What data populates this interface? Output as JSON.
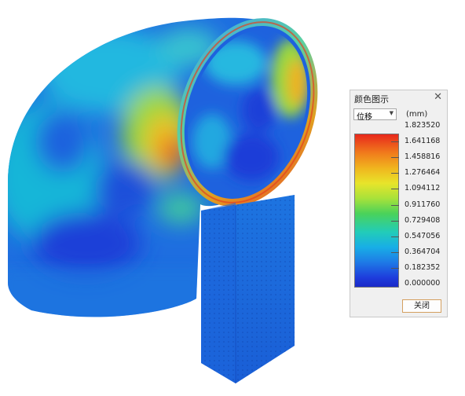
{
  "legend": {
    "title": "颜色图示",
    "close_icon": "close-icon",
    "quantity_select": {
      "value": "位移",
      "arrow_icon": "chevron-down-icon"
    },
    "unit": "(mm)",
    "max_color": "#e8281c",
    "min_color": "#1a2ac8",
    "labels": [
      "1.823520",
      "1.641168",
      "1.458816",
      "1.276464",
      "1.094112",
      "0.911760",
      "0.729408",
      "0.547056",
      "0.364704",
      "0.182352",
      "0.000000"
    ],
    "close_button": "关闭"
  }
}
